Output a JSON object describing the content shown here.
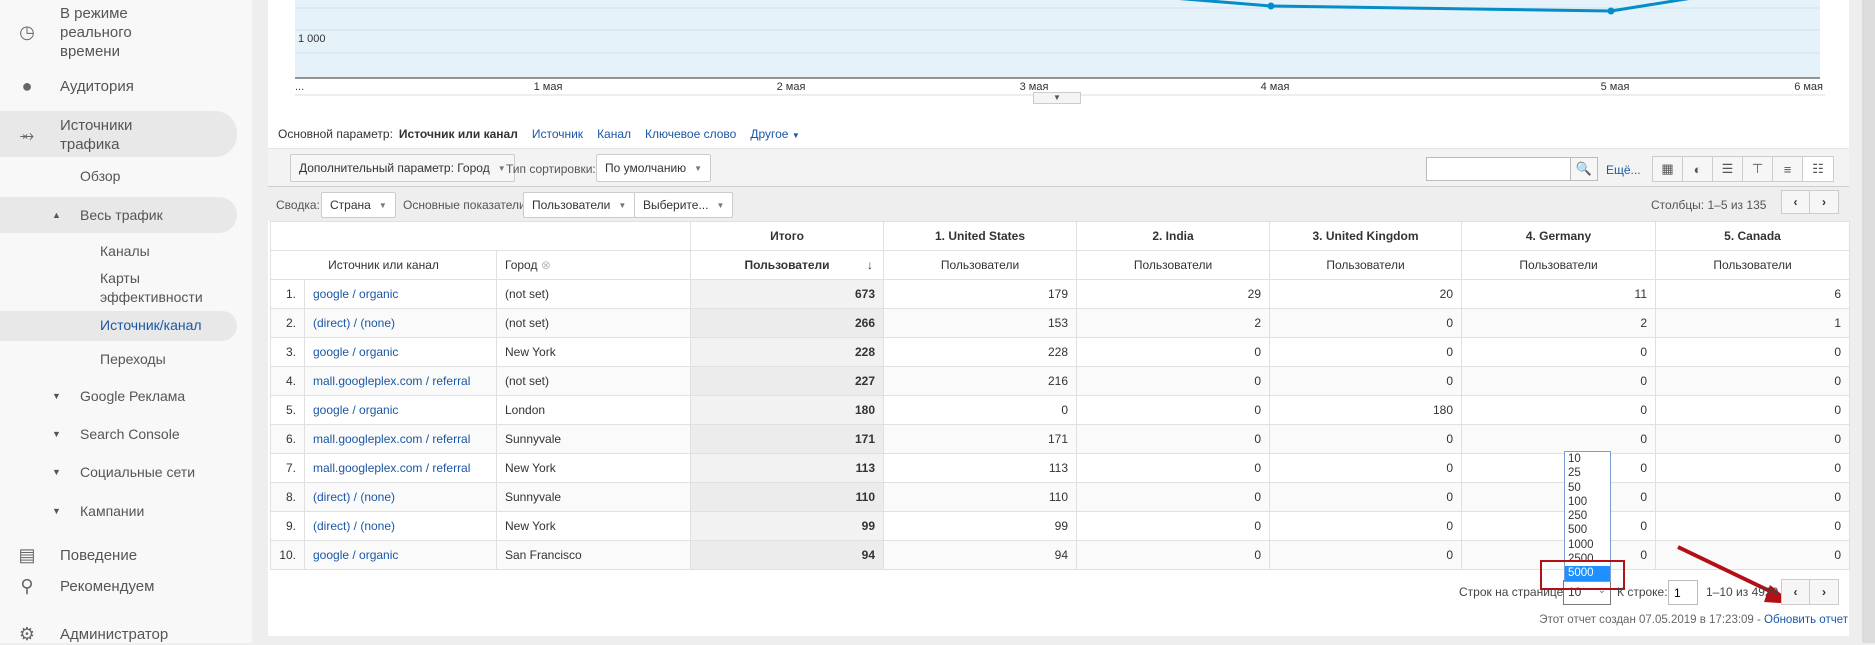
{
  "sidebar": {
    "items": [
      {
        "label": "В режиме реального времени",
        "icon": "clock-icon"
      },
      {
        "label": "Аудитория",
        "icon": "person-icon"
      },
      {
        "label": "Источники трафика",
        "icon": "acquisition-icon"
      },
      {
        "label": "Обзор"
      },
      {
        "label": "Весь трафик"
      },
      {
        "label": "Каналы"
      },
      {
        "label": "Карты эффективности"
      },
      {
        "label": "Источник/канал"
      },
      {
        "label": "Переходы"
      },
      {
        "label": "Google Реклама"
      },
      {
        "label": "Search Console"
      },
      {
        "label": "Социальные сети"
      },
      {
        "label": "Кампании"
      },
      {
        "label": "Поведение",
        "icon": "behavior-icon"
      },
      {
        "label": "Рекомендуем",
        "icon": "lightbulb-icon"
      },
      {
        "label": "Администратор",
        "icon": "gear-icon"
      }
    ]
  },
  "chart": {
    "y_tick": "1 000",
    "x_labels": [
      "...",
      "1 мая",
      "2 мая",
      "3 мая",
      "4 мая",
      "5 мая",
      "6 мая"
    ],
    "line_color": "#058dc7",
    "fill_color": "#e5f2f9"
  },
  "dims": {
    "label": "Основной параметр:",
    "active": "Источник или канал",
    "links": [
      "Источник",
      "Канал",
      "Ключевое слово",
      "Другое"
    ]
  },
  "toolbar": {
    "secondary": "Дополнительный параметр: Город",
    "sort_label": "Тип сортировки:",
    "sort_value": "По умолчанию",
    "search_placeholder": "",
    "more": "Ещё..."
  },
  "pivot": {
    "summary_label": "Сводка:",
    "summary_value": "Страна",
    "metrics_label": "Основные показатели:",
    "metric1": "Пользователи",
    "metric2": "Выберите...",
    "columns": "Столбцы:",
    "columns_range": "1–5 из 135"
  },
  "table": {
    "total_header": "Итого",
    "country_headers": [
      "1. United States",
      "2. India",
      "3. United Kingdom",
      "4. Germany",
      "5. Canada"
    ],
    "dim1": "Источник или канал",
    "dim2": "Город",
    "metric": "Пользователи",
    "rows": [
      [
        "1.",
        "google / organic",
        "(not set)",
        "673",
        "179",
        "29",
        "20",
        "11",
        "6"
      ],
      [
        "2.",
        "(direct) / (none)",
        "(not set)",
        "266",
        "153",
        "2",
        "0",
        "2",
        "1"
      ],
      [
        "3.",
        "google / organic",
        "New York",
        "228",
        "228",
        "0",
        "0",
        "0",
        "0"
      ],
      [
        "4.",
        "mall.googleplex.com / referral",
        "(not set)",
        "227",
        "216",
        "0",
        "0",
        "0",
        "0"
      ],
      [
        "5.",
        "google / organic",
        "London",
        "180",
        "0",
        "0",
        "180",
        "0",
        "0"
      ],
      [
        "6.",
        "mall.googleplex.com / referral",
        "Sunnyvale",
        "171",
        "171",
        "0",
        "0",
        "0",
        "0"
      ],
      [
        "7.",
        "mall.googleplex.com / referral",
        "New York",
        "113",
        "113",
        "0",
        "0",
        "0",
        "0"
      ],
      [
        "8.",
        "(direct) / (none)",
        "Sunnyvale",
        "110",
        "110",
        "0",
        "0",
        "0",
        "0"
      ],
      [
        "9.",
        "(direct) / (none)",
        "New York",
        "99",
        "99",
        "0",
        "0",
        "0",
        "0"
      ],
      [
        "10.",
        "google / organic",
        "San Francisco",
        "94",
        "94",
        "0",
        "0",
        "0",
        "0"
      ]
    ]
  },
  "pager": {
    "rows_label": "Строк на странице:",
    "rows_value": "10",
    "options": [
      "10",
      "25",
      "50",
      "100",
      "250",
      "500",
      "1000",
      "2500",
      "5000"
    ],
    "selected_option": "5000",
    "goto_label": "К строке:",
    "goto_value": "1",
    "range": "1–10 из 4929"
  },
  "footer": {
    "created": "Этот отчет создан 07.05.2019 в 17:23:09 - ",
    "refresh": "Обновить отчет"
  },
  "annotation_color": "#b30f14"
}
